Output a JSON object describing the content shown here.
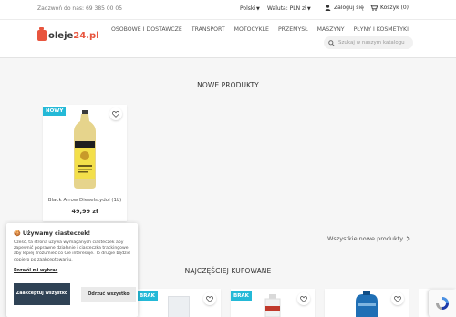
{
  "topbar": {
    "phone": "Zadzwoń do nas: 69 385 00 05",
    "language": "Polski",
    "currency": "Waluta: PLN zł",
    "login": "Zaloguj się",
    "cart": "Koszyk (0)"
  },
  "logo": {
    "text_main": "oleje",
    "text_accent": "24.pl"
  },
  "nav": {
    "items": [
      "OSOBOWE I DOSTAWCZE",
      "TRANSPORT",
      "MOTOCYKLE",
      "PRZEMYSŁ",
      "MASZYNY",
      "PŁYNY I KOSMETYKI"
    ]
  },
  "search": {
    "placeholder": "Szukaj w naszym katalogu"
  },
  "new_products": {
    "title": "NOWE PRODUKTY",
    "product": {
      "badge": "NOWY",
      "name": "Black Arrow Dieselstydol (1L)",
      "price": "49,99 zł"
    },
    "all_link": "Wszystkie nowe produkty"
  },
  "bestsellers": {
    "title": "NAJCZĘŚCIEJ KUPOWANE",
    "badges": [
      "BRAK",
      "BRAK"
    ]
  },
  "cookie": {
    "title": "🍪 Używamy ciasteczek!",
    "body": "Cześć, ta strona używa wymaganych ciasteczek aby zapewnić poprawne działanie i ciasteczka trackingowe aby lepiej zrozumieć co Cie interesuje. To drugie będzie dopiero po zaakceptowaniu.",
    "more_link": "Pozwól mi wybrać",
    "accept_button": "Zaakceptuj wszystko",
    "reject_button": "Odrzuć wszystko"
  },
  "colors": {
    "accent": "#e8553e",
    "badge": "#24b9d7",
    "cookie_button": "#2f4255"
  },
  "icons": [
    "user-icon",
    "cart-icon",
    "search-icon",
    "heart-icon",
    "chevron-right-icon",
    "recaptcha-icon"
  ]
}
